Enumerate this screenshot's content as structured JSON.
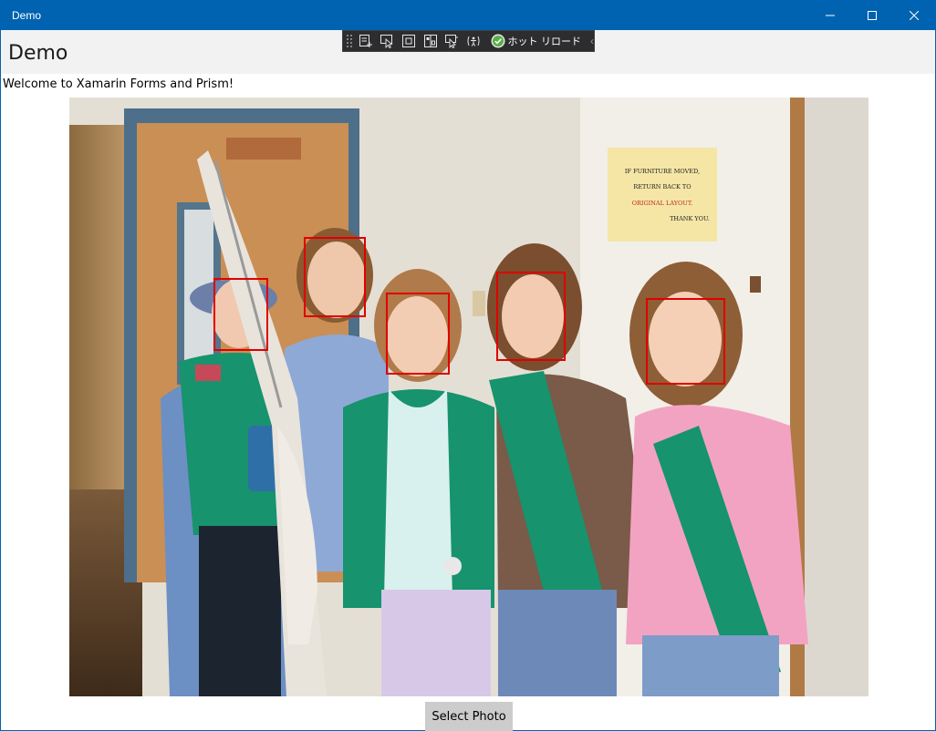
{
  "window": {
    "title": "Demo",
    "controls": [
      "minimize-icon",
      "maximize-icon",
      "close-icon"
    ],
    "accent_color": "#0063b1"
  },
  "header": {
    "title": "Demo"
  },
  "devtools": {
    "tools": [
      "add-element-icon",
      "select-element-icon",
      "display-layout-adorners-icon",
      "track-focus-icon",
      "binding-failures-icon",
      "accessibility-icon"
    ],
    "hot_reload_label": "ホット リロード",
    "hot_reload_status_icon": "check-circle-icon"
  },
  "content": {
    "welcome_text": "Welcome to Xamarin Forms and Prism!",
    "photo_subject": "group of five girls in green sashes",
    "sign_lines": [
      "IF FURNITURE MOVED,",
      "RETURN BACK TO",
      "ORIGINAL LAYOUT.",
      "THANK YOU."
    ],
    "detected_faces": 5,
    "face_box_color": "#e00000",
    "select_button_label": "Select Photo"
  }
}
